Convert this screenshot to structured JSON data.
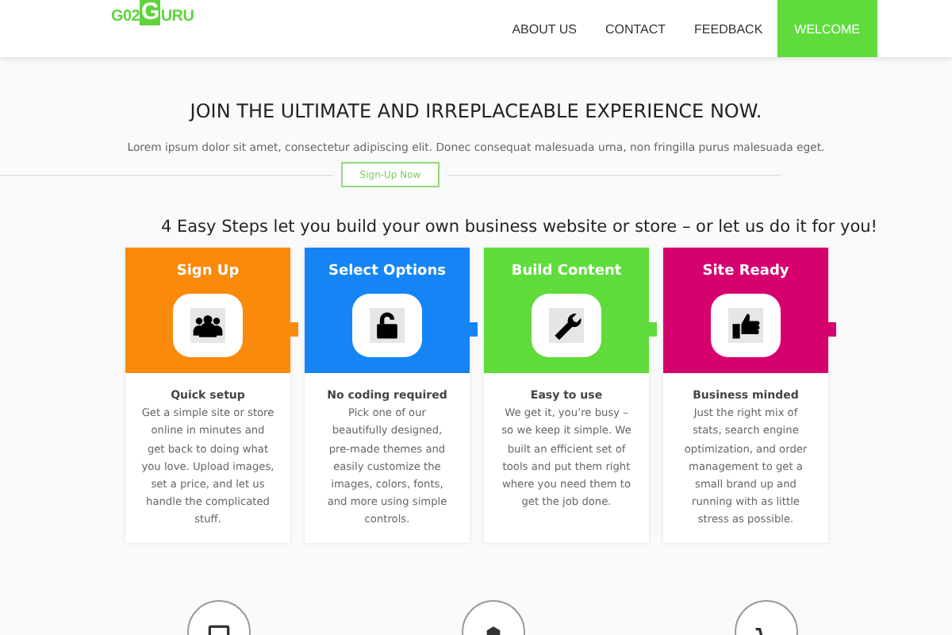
{
  "logo": {
    "parts": [
      "G02",
      "G",
      "URU"
    ]
  },
  "nav": [
    {
      "label": "ABOUT US",
      "selected": false
    },
    {
      "label": "CONTACT",
      "selected": false
    },
    {
      "label": "FEEDBACK",
      "selected": false
    },
    {
      "label": "WELCOME",
      "selected": true
    }
  ],
  "hero": {
    "title": "JOIN THE ULTIMATE AND IRREPLACEABLE EXPERIENCE NOW.",
    "text": "Lorem ipsum dolor sit amet, consectetur adipiscing elit. Donec consequat malesuada urna, non fringilla purus malesuada eget.",
    "button": "Sign-Up Now"
  },
  "steps_heading": "4 Easy Steps let you build your own business website or store – or let us do it for you!",
  "steps": [
    {
      "title": "Sign Up",
      "color": "#f98a0c",
      "subtitle": "Quick setup",
      "text": "Get a simple site or store online in minutes and get back to doing what you love. Upload images, set a price, and let us handle the complicated stuff."
    },
    {
      "title": "Select Options",
      "color": "#1585f5",
      "subtitle": "No coding required",
      "text": "Pick one of our beautifully designed, pre-made themes and easily customize the images, colors, fonts, and more using simple controls."
    },
    {
      "title": "Build Content",
      "color": "#5fdc3c",
      "subtitle": "Easy to use",
      "text": "We get it, you’re busy – so we keep it simple. We built an efficient set of tools and put them right where you need them to get the job done."
    },
    {
      "title": "Site Ready",
      "color": "#d6006f",
      "subtitle": "Business minded",
      "text": "Just the right mix of stats, search engine optimization, and order management to get a small brand up and running with as little stress as possible."
    }
  ]
}
